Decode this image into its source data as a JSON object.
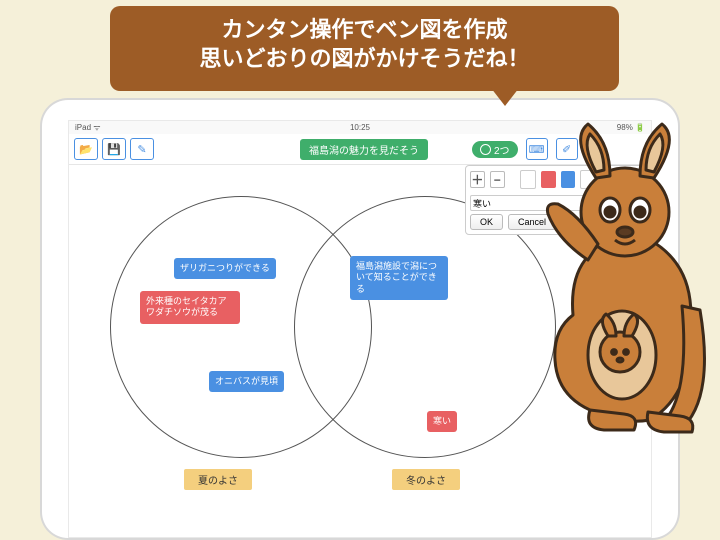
{
  "banner": {
    "line1": "カンタン操作でベン図を作成",
    "line2": "思いどおりの図がかけそうだね！"
  },
  "status": {
    "left": "iPad ᯤ",
    "time": "10:25",
    "right": "98% 🔋"
  },
  "toolbar": {
    "open_icon": "📂",
    "save_icon": "💾",
    "pen_icon": "✎",
    "title": "福島潟の魅力を見だそう",
    "count_label": "2つ",
    "text_icon": "⌨",
    "pen2_icon": "✐"
  },
  "palette": {
    "plus": "＋",
    "minus": "−",
    "input_value": "寒い",
    "ok": "OK",
    "cancel": "Cancel"
  },
  "notes": {
    "n1": "ザリガニつりができる",
    "n2": "外来種のセイタカアワダチソウが茂る",
    "n3": "オニバスが見頃",
    "n4": "福島潟施設で潟について知ることができる",
    "n5": "寒い"
  },
  "captions": {
    "left": "夏のよさ",
    "right": "冬のよさ"
  }
}
